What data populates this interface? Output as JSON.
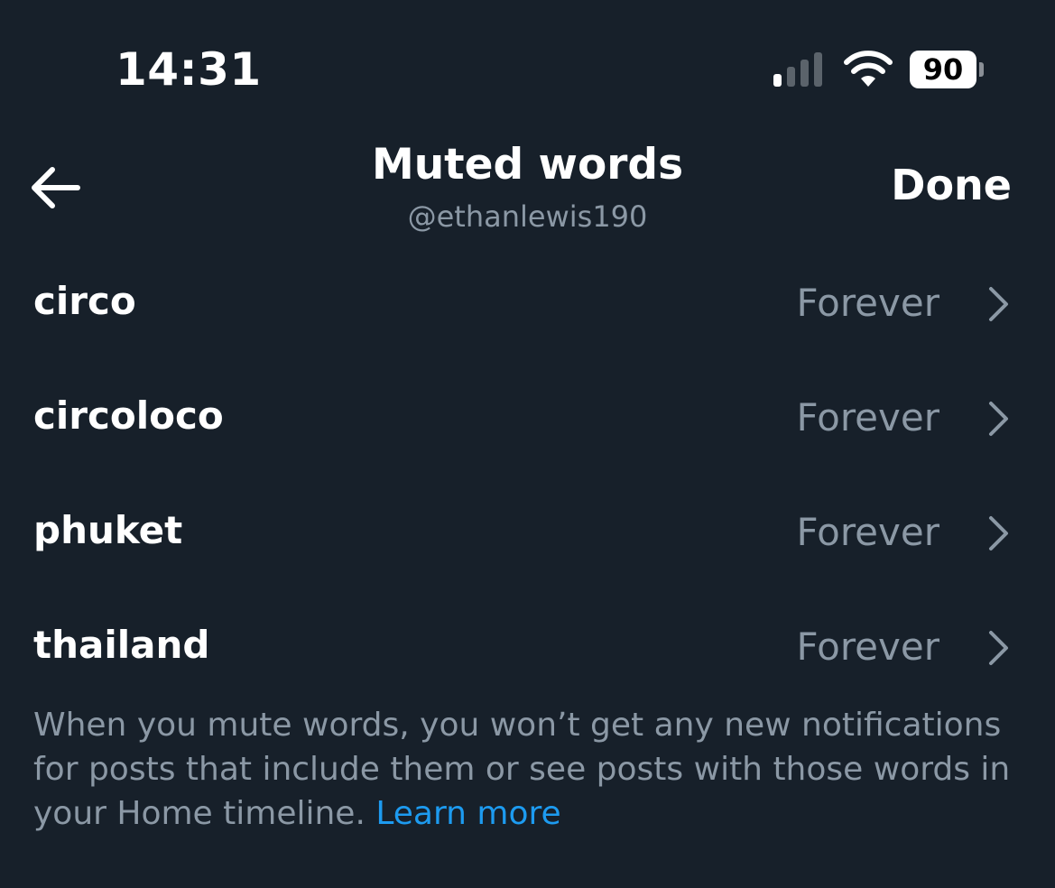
{
  "status_bar": {
    "time": "14:31",
    "battery_level": "90",
    "signal_icon": "cellular-signal-icon",
    "wifi_icon": "wifi-icon"
  },
  "header": {
    "title": "Muted words",
    "username": "@ethanlewis190",
    "done_label": "Done",
    "back_icon": "back-arrow-icon"
  },
  "muted_words": [
    {
      "word": "circo",
      "duration": "Forever"
    },
    {
      "word": "circoloco",
      "duration": "Forever"
    },
    {
      "word": "phuket",
      "duration": "Forever"
    },
    {
      "word": "thailand",
      "duration": "Forever"
    }
  ],
  "footer": {
    "description": "When you mute words, you won’t get any new notifications for posts that include them or see posts with those words in your Home timeline.",
    "learn_more": "Learn more"
  },
  "colors": {
    "background": "#17202a",
    "primary_text": "#ffffff",
    "secondary_text": "#8b98a5",
    "link": "#1d9bf0"
  }
}
